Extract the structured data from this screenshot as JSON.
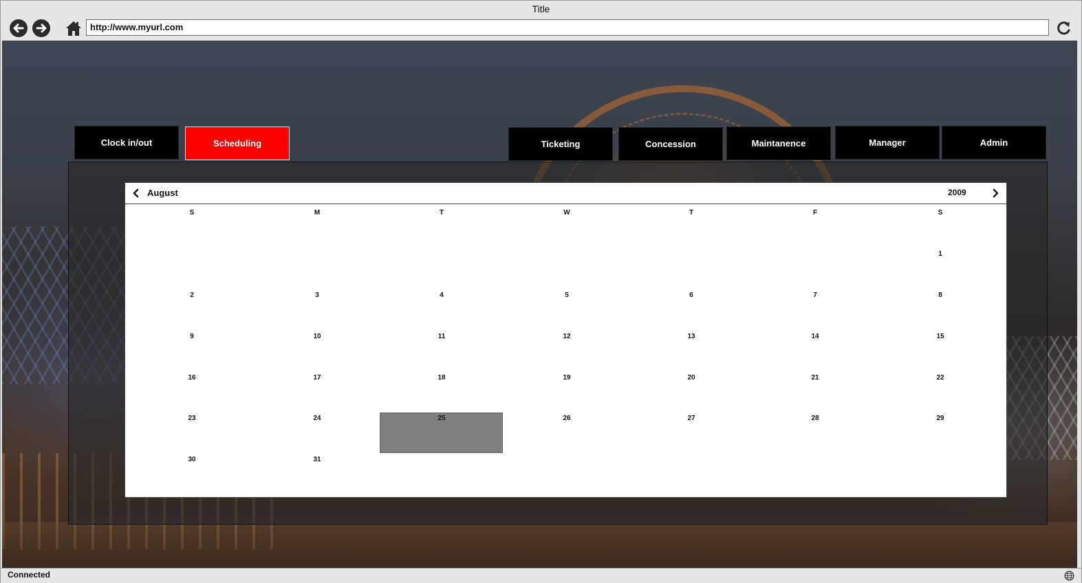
{
  "window": {
    "title": "Title"
  },
  "toolbar": {
    "url": "http://www.myurl.com"
  },
  "tabs": {
    "clock": "Clock in/out",
    "scheduling": "Scheduling",
    "ticketing": "Ticketing",
    "concession": "Concession",
    "maintenance": "Maintanence",
    "manager": "Manager",
    "admin": "Admin"
  },
  "calendar": {
    "month": "August",
    "year": "2009",
    "weekdays": [
      "S",
      "M",
      "T",
      "W",
      "T",
      "F",
      "S"
    ],
    "selected_day": "25",
    "weeks": [
      [
        "",
        "",
        "",
        "",
        "",
        "",
        "1"
      ],
      [
        "2",
        "3",
        "4",
        "5",
        "6",
        "7",
        "8"
      ],
      [
        "9",
        "10",
        "11",
        "12",
        "13",
        "14",
        "15"
      ],
      [
        "16",
        "17",
        "18",
        "19",
        "20",
        "21",
        "22"
      ],
      [
        "23",
        "24",
        "25",
        "26",
        "27",
        "28",
        "29"
      ],
      [
        "30",
        "31",
        "",
        "",
        "",
        "",
        ""
      ]
    ]
  },
  "status": {
    "text": "Connected"
  },
  "colors": {
    "active_tab": "#ff0000",
    "tab": "#000000",
    "selected_day": "#7f7f7f"
  }
}
